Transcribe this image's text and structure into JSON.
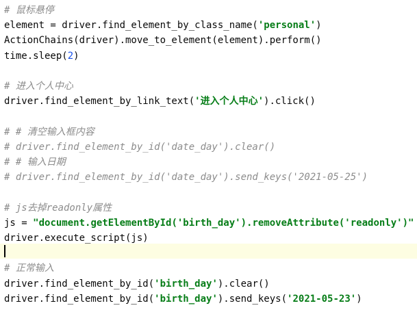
{
  "editor": {
    "lines": [
      {
        "segments": [
          {
            "text": "# 鼠标悬停",
            "type": "comment"
          }
        ]
      },
      {
        "segments": [
          {
            "text": "element = driver.find_element_by_class_name(",
            "type": "code"
          },
          {
            "text": "'personal'",
            "type": "str"
          },
          {
            "text": ")",
            "type": "code"
          }
        ]
      },
      {
        "segments": [
          {
            "text": "ActionChains(driver).move_to_element(element).perform()",
            "type": "code"
          }
        ]
      },
      {
        "segments": [
          {
            "text": "time.sleep(",
            "type": "code"
          },
          {
            "text": "2",
            "type": "num"
          },
          {
            "text": ")",
            "type": "code"
          }
        ]
      },
      {
        "segments": []
      },
      {
        "segments": [
          {
            "text": "# 进入个人中心",
            "type": "comment"
          }
        ]
      },
      {
        "segments": [
          {
            "text": "driver.find_element_by_link_text(",
            "type": "code"
          },
          {
            "text": "'进入个人中心'",
            "type": "str"
          },
          {
            "text": ").click()",
            "type": "code"
          }
        ]
      },
      {
        "segments": []
      },
      {
        "segments": [
          {
            "text": "# # 清空输入框内容",
            "type": "comment"
          }
        ]
      },
      {
        "segments": [
          {
            "text": "# driver.find_element_by_id('date_day').clear()",
            "type": "comment"
          }
        ]
      },
      {
        "segments": [
          {
            "text": "# # 输入日期",
            "type": "comment"
          }
        ]
      },
      {
        "segments": [
          {
            "text": "# driver.find_element_by_id('date_day').send_keys('2021-05-25')",
            "type": "comment"
          }
        ]
      },
      {
        "segments": []
      },
      {
        "segments": [
          {
            "text": "# js去掉readonly属性",
            "type": "comment"
          }
        ]
      },
      {
        "segments": [
          {
            "text": "js = ",
            "type": "code"
          },
          {
            "text": "\"document.getElementById('birth_day').removeAttribute('readonly')\"",
            "type": "str"
          }
        ]
      },
      {
        "segments": [
          {
            "text": "driver.execute_script(js)",
            "type": "code"
          }
        ]
      },
      {
        "segments": []
      },
      {
        "segments": [
          {
            "text": "# 正常输入",
            "type": "comment"
          }
        ]
      },
      {
        "segments": [
          {
            "text": "driver.find_element_by_id(",
            "type": "code"
          },
          {
            "text": "'birth_day'",
            "type": "str"
          },
          {
            "text": ").clear()",
            "type": "code"
          }
        ]
      },
      {
        "segments": [
          {
            "text": "driver.find_element_by_id(",
            "type": "code"
          },
          {
            "text": "'birth_day'",
            "type": "str"
          },
          {
            "text": ").send_keys(",
            "type": "code"
          },
          {
            "text": "'2021-05-23'",
            "type": "str"
          },
          {
            "text": ")",
            "type": "code"
          }
        ]
      }
    ]
  }
}
